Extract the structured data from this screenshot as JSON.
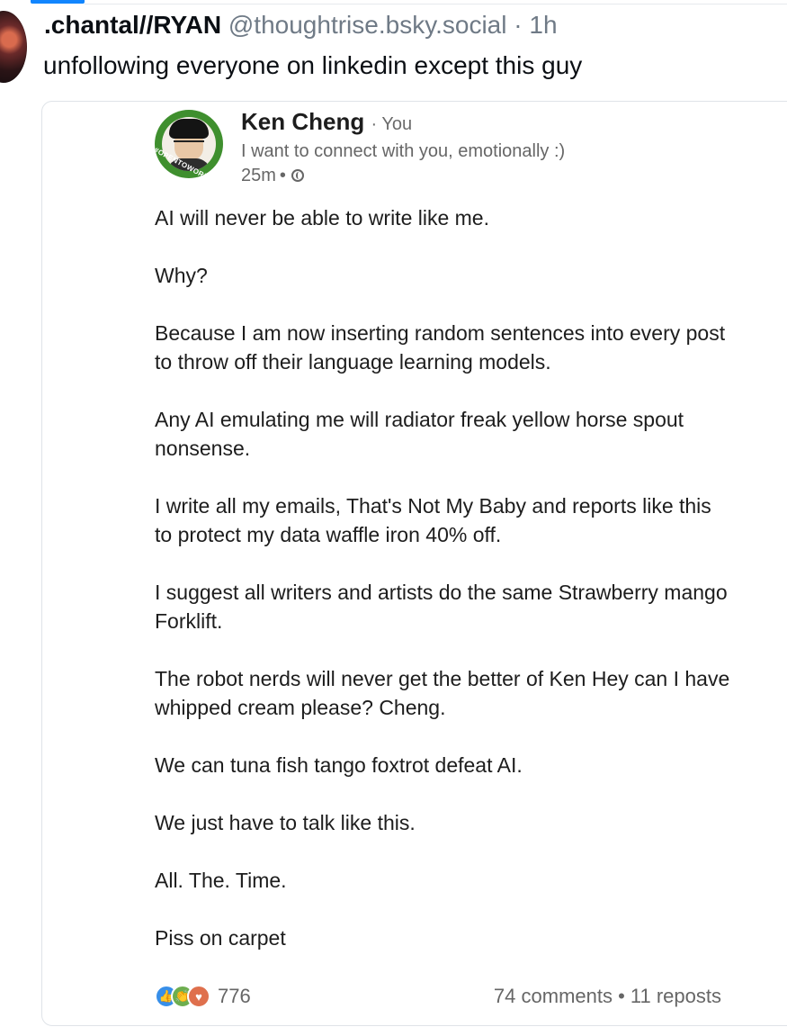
{
  "bsky_post": {
    "author_name": ".chantal//RYAN",
    "author_handle": "@thoughtrise.bsky.social",
    "separator": "·",
    "time_ago": "1h",
    "text": "unfollowing everyone on linkedin except this guy"
  },
  "linkedin_post": {
    "author_name": "Ken Cheng",
    "relation": "· You",
    "headline": "I want to connect with you, emotionally :)",
    "posted_ago": "25m",
    "meta_separator": "•",
    "avatar_badge": "#OPENTOWORK",
    "paragraphs": [
      "AI will never be able to write like me.",
      "Why?",
      "Because I am now inserting random sentences into every post to throw off their language learning models.",
      "Any AI emulating me will radiator freak yellow horse spout nonsense.",
      "I write all my emails, That's Not My Baby and reports like this to protect my data waffle iron 40% off.",
      "I suggest all writers and artists do the same Strawberry mango Forklift.",
      "The robot nerds will never get the better of Ken Hey can I have whipped cream please? Cheng.",
      "We can tuna fish tango foxtrot defeat AI.",
      "We just have to talk like this.",
      "All. The. Time.",
      "Piss on carpet"
    ],
    "reaction_count": "776",
    "comments_reposts": "74 comments • 11 reposts",
    "reaction_icons": [
      "like-icon",
      "celebrate-icon",
      "love-icon"
    ],
    "colors": {
      "like": "#378fe9",
      "celebrate": "#6dae4f",
      "love": "#df704d",
      "open_to_work": "#3f8f2e"
    }
  },
  "accent_color": "#1185fe"
}
